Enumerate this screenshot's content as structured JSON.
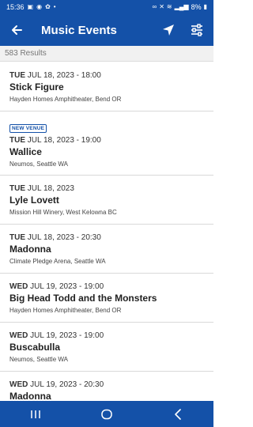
{
  "status_bar": {
    "time": "15:36",
    "battery": "8%"
  },
  "app_bar": {
    "title": "Music Events",
    "back_icon": "arrow-left-icon",
    "location_icon": "location-arrow-icon",
    "filter_icon": "sliders-icon"
  },
  "results": {
    "count_text": "583 Results"
  },
  "events": [
    {
      "badge": "",
      "dow": "TUE",
      "date": " JUL 18, 2023 - 18:00",
      "name": "Stick Figure",
      "venue": "Hayden Homes Amphitheater, Bend OR"
    },
    {
      "badge": "NEW VENUE",
      "dow": "TUE",
      "date": " JUL 18, 2023 - 19:00",
      "name": "Wallice",
      "venue": "Neumos, Seattle WA"
    },
    {
      "badge": "",
      "dow": "TUE",
      "date": " JUL 18, 2023",
      "name": "Lyle Lovett",
      "venue": "Mission Hill Winery, West Kelowna BC"
    },
    {
      "badge": "",
      "dow": "TUE",
      "date": " JUL 18, 2023 - 20:30",
      "name": "Madonna",
      "venue": "Climate Pledge Arena, Seattle WA"
    },
    {
      "badge": "",
      "dow": "WED",
      "date": " JUL 19, 2023 - 19:00",
      "name": "Big Head Todd and the Monsters",
      "venue": "Hayden Homes Amphitheater, Bend OR"
    },
    {
      "badge": "",
      "dow": "WED",
      "date": " JUL 19, 2023 - 19:00",
      "name": "Buscabulla",
      "venue": "Neumos, Seattle WA"
    },
    {
      "badge": "",
      "dow": "WED",
      "date": " JUL 19, 2023 - 20:30",
      "name": "Madonna",
      "venue": ""
    }
  ],
  "nav": {
    "recents_icon": "recents-icon",
    "home_icon": "home-icon",
    "back_icon": "nav-back-icon"
  },
  "colors": {
    "primary": "#1451a8",
    "badge": "#1451a8"
  }
}
